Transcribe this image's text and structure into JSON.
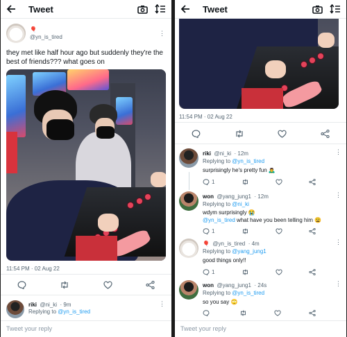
{
  "left": {
    "header": {
      "title": "Tweet",
      "back_icon": "back-arrow-icon",
      "camera_icon": "camera-icon",
      "sort_icon": "sort-icon"
    },
    "tweet": {
      "emoji": "🎈",
      "handle": "@yn_is_tired",
      "text": "they met like half hour ago but suddenly they're the best of friends??? what goes on",
      "timestamp": "11:54 PM · 02 Aug 22"
    },
    "reply": {
      "name": "riki",
      "handle": "@ni_ki",
      "time": "· 9m",
      "replying_prefix": "Replying to",
      "replying_to": "@yn_is_tired"
    },
    "reply_bar": {
      "placeholder": "Tweet your reply"
    }
  },
  "right": {
    "header": {
      "title": "Tweet"
    },
    "tweet": {
      "timestamp": "11:54 PM · 02 Aug 22"
    },
    "replies": [
      {
        "name": "riki",
        "handle": "@ni_ki",
        "time": "· 12m",
        "replying_prefix": "Replying to",
        "replying_to": "@yn_is_tired",
        "text": "surprisingly he's pretty fun 🙇‍♂️",
        "reply_count": "1"
      },
      {
        "name": "won",
        "handle": "@yang_jung1",
        "time": "· 12m",
        "replying_prefix": "Replying to",
        "replying_to": "@ni_ki",
        "text_line1": "wdym surprisingly 😭",
        "mention": "@yn_is_tired",
        "text_line2": "what have you been telling him 😩",
        "reply_count": "1"
      },
      {
        "emoji": "🎈",
        "handle": "@yn_is_tired",
        "time": "· 4m",
        "replying_prefix": "Replying to",
        "replying_to": "@yang_jung1",
        "text": "good things only!!",
        "reply_count": "1"
      },
      {
        "name": "won",
        "handle": "@yang_jung1",
        "time": "· 24s",
        "replying_prefix": "Replying to",
        "replying_to": "@yn_is_tired",
        "text": "so you say 🙄",
        "reply_count": ""
      }
    ],
    "reply_bar": {
      "placeholder": "Tweet your reply"
    }
  },
  "colors": {
    "link": "#1d9bf0",
    "muted": "#536471",
    "divider": "#e8eaec"
  }
}
